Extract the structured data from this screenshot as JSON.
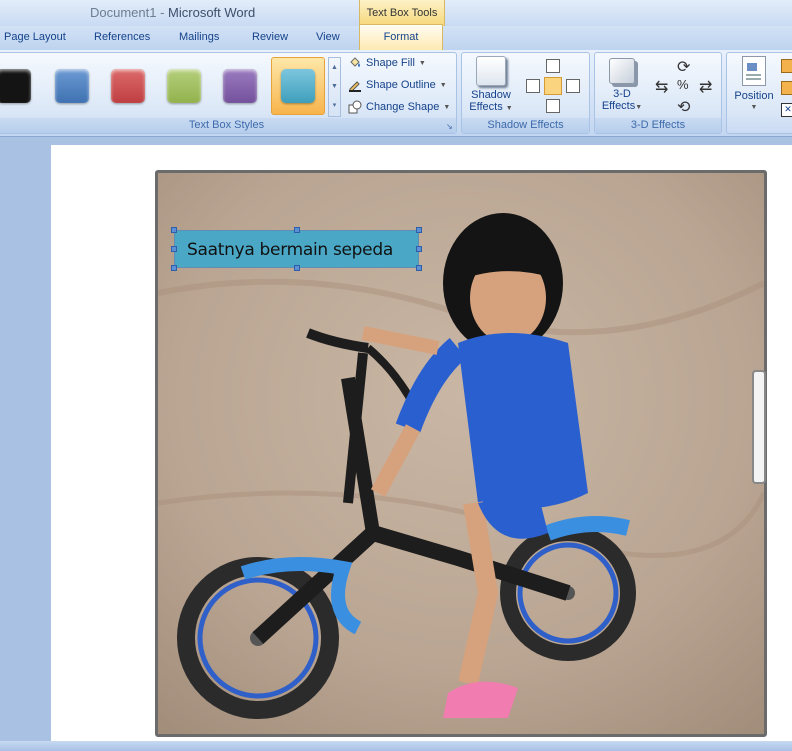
{
  "title": {
    "document": "Document1",
    "separator": " - ",
    "app": "Microsoft Word"
  },
  "contextual_tab_header": "Text Box Tools",
  "tabs": [
    {
      "label": "Page Layout"
    },
    {
      "label": "References"
    },
    {
      "label": "Mailings"
    },
    {
      "label": "Review"
    },
    {
      "label": "View"
    },
    {
      "label": "Format",
      "active": true
    }
  ],
  "ribbon": {
    "text_box_styles": {
      "label": "Text Box Styles",
      "swatches": [
        "#141414",
        "#4a7ebd",
        "#c9484a",
        "#9cbb58",
        "#7e5aa6",
        "#4aacc5"
      ],
      "selected_swatch": "#4aacc5",
      "commands": [
        {
          "label": "Shape Fill",
          "icon": "paint-bucket-icon"
        },
        {
          "label": "Shape Outline",
          "icon": "pencil-icon"
        },
        {
          "label": "Change Shape",
          "icon": "shapes-icon"
        }
      ]
    },
    "shadow_effects": {
      "label": "Shadow Effects",
      "button_line1": "Shadow",
      "button_line2": "Effects"
    },
    "three_d_effects": {
      "label": "3-D Effects",
      "button_line1": "3-D",
      "button_line2": "Effects"
    },
    "arrange": {
      "position_label": "Position"
    }
  },
  "document": {
    "textbox_text": "Saatnya bermain  sepeda",
    "textbox_fill": "#4aa8c6"
  }
}
